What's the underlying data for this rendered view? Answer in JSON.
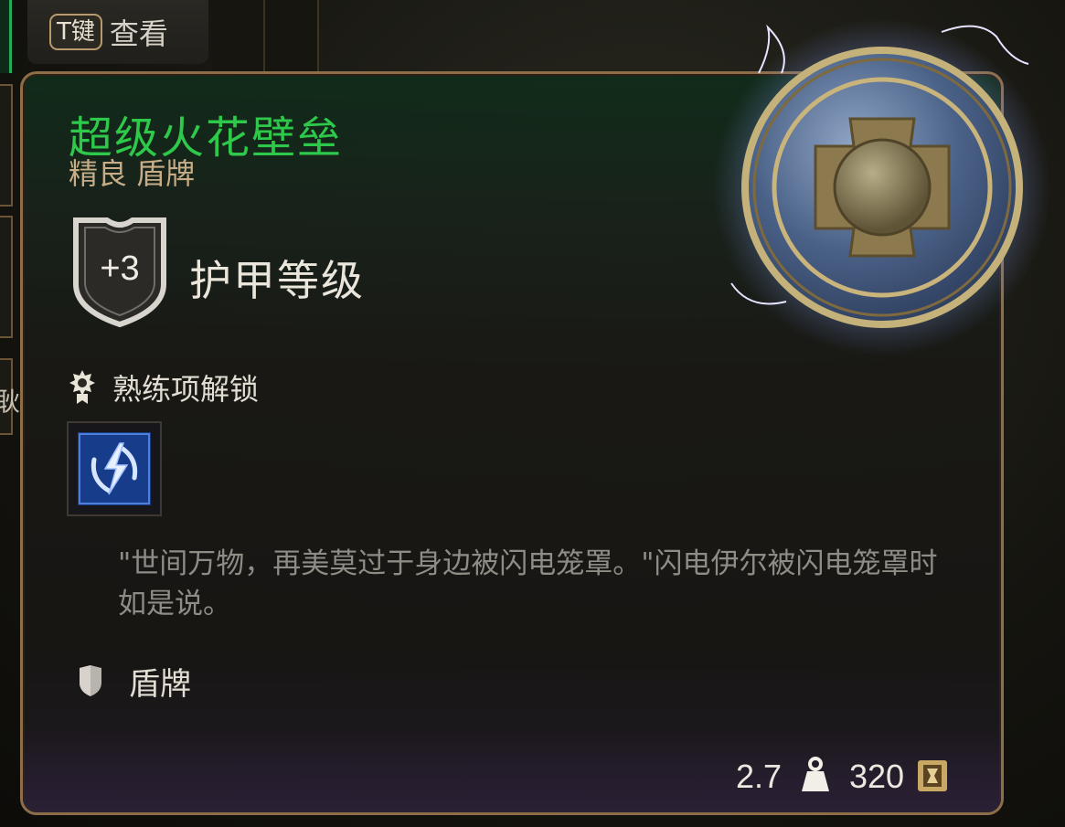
{
  "hint": {
    "key": "T键",
    "label": "查看"
  },
  "left": {
    "cut_text": "耿"
  },
  "item": {
    "name": "超级火花壁垒",
    "rarity_type": "精良 盾牌",
    "name_color": "#2ec84a",
    "armor": {
      "value": "+3",
      "label": "护甲等级"
    },
    "proficiency": {
      "label": "熟练项解锁",
      "spell_icon": "lightning-shield-icon"
    },
    "flavor": "\"世间万物，再美莫过于身边被闪电笼罩。\"闪电伊尔被闪电笼罩时如是说。",
    "category": "盾牌",
    "weight": "2.7",
    "price": "320"
  }
}
